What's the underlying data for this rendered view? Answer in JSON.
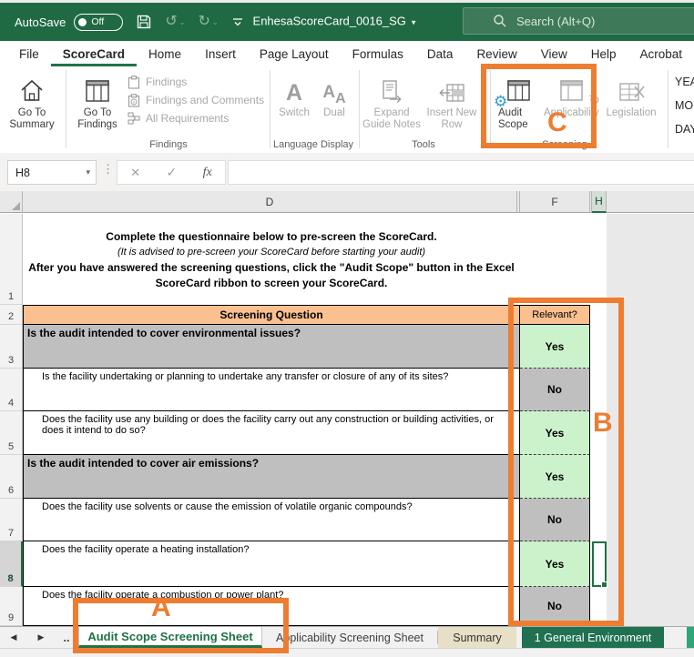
{
  "titlebar": {
    "autosave_label": "AutoSave",
    "autosave_state": "Off",
    "doc_title": "EnhesaScoreCard_0016_SG",
    "search_placeholder": "Search (Alt+Q)"
  },
  "ribbon_tabs": {
    "file": "File",
    "scorecard": "ScoreCard",
    "home": "Home",
    "insert": "Insert",
    "page_layout": "Page Layout",
    "formulas": "Formulas",
    "data": "Data",
    "review": "Review",
    "view": "View",
    "help": "Help",
    "acrobat": "Acrobat"
  },
  "ribbon": {
    "go_to_summary": "Go To Summary",
    "findings": {
      "go_to_findings": "Go To Findings",
      "item1": "Findings",
      "item2": "Findings and Comments",
      "item3": "All Requirements",
      "group_label": "Findings"
    },
    "language": {
      "switch_label": "Switch",
      "dual_label": "Dual",
      "group_label": "Language Display"
    },
    "tools": {
      "expand": "Expand Guide Notes",
      "insert_row": "Insert New Row",
      "group_label": "Tools"
    },
    "screening": {
      "audit_scope": "Audit Scope",
      "applicability": "Applicability",
      "legislation": "Legislation",
      "group_label": "Screening"
    },
    "cut_labels": {
      "year": "YEA",
      "month": "MO",
      "day": "DAY"
    }
  },
  "formula_bar": {
    "name_box": "H8",
    "formula_value": ""
  },
  "column_headers": {
    "d": "D",
    "f": "F",
    "h": "H"
  },
  "sheet": {
    "row1_num": "1",
    "instructions": {
      "line1": "Complete the questionnaire below to pre-screen the ScoreCard.",
      "line2": "(It is advised to pre-screen your ScoreCard before starting your audit)",
      "line3": "After you have answered the screening questions, click the \"Audit Scope\" button in the Excel",
      "line4": "ScoreCard ribbon to screen your ScoreCard."
    },
    "header_row": {
      "row_num": "2",
      "question": "Screening Question",
      "relevant": "Relevant?"
    },
    "rows": [
      {
        "num": "3",
        "type": "section",
        "text": "Is the audit intended to cover environmental issues?",
        "answer": "Yes"
      },
      {
        "num": "4",
        "type": "question",
        "text": "Is the facility undertaking or planning to undertake any transfer or closure of any of its sites?",
        "answer": "No"
      },
      {
        "num": "5",
        "type": "question",
        "text": "Does the facility use any building or does the facility carry out any construction or building activities, or does it intend to do so?",
        "answer": "Yes"
      },
      {
        "num": "6",
        "type": "section",
        "text": "Is the audit intended to cover air emissions?",
        "answer": "Yes"
      },
      {
        "num": "7",
        "type": "question",
        "text": "Does the facility use solvents or cause the emission of volatile organic compounds?",
        "answer": "No"
      },
      {
        "num": "8",
        "type": "question",
        "text": "Does the facility operate a heating installation?",
        "answer": "Yes",
        "selected_cell": "H8"
      },
      {
        "num": "9",
        "type": "question",
        "text": "Does the facility operate a combustion or power plant?",
        "answer": "No"
      }
    ]
  },
  "sheet_tabs": {
    "overflow": "..",
    "active": "Audit Scope Screening Sheet",
    "tab2": "Applicability Screening Sheet",
    "tab3": "Summary",
    "tab4": "1 General Environment"
  },
  "annotations": {
    "a": "A",
    "b": "B",
    "c": "C"
  },
  "colors": {
    "titlebar_green": "#206A43",
    "accent_green": "#217346",
    "callout_orange": "#ED7D31",
    "header_peach": "#FAC090",
    "yes_green": "#CCF2CC",
    "no_gray": "#BFBFBF",
    "summary_tab_beige": "#E7DFC6",
    "general_env_tab_green": "#1F7150",
    "audit_scope_gear_blue": "#2E9BD8"
  }
}
